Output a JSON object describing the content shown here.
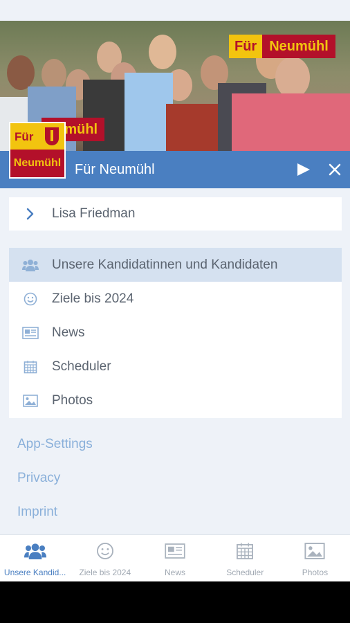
{
  "header": {
    "banner_left": "Für",
    "banner_right": "Neumühl",
    "banner2_right": "eumühl",
    "logo_top": "Für",
    "logo_bottom": "Neumühl",
    "title": "Für Neumühl"
  },
  "user": {
    "name": "Lisa Friedman"
  },
  "menu": {
    "items": [
      {
        "label": "Unsere Kandidatinnen und Kandidaten",
        "icon": "users-icon",
        "active": true
      },
      {
        "label": "Ziele bis 2024",
        "icon": "smiley-icon"
      },
      {
        "label": "News",
        "icon": "newspaper-icon"
      },
      {
        "label": "Scheduler",
        "icon": "calendar-icon"
      },
      {
        "label": "Photos",
        "icon": "image-icon"
      }
    ]
  },
  "links": [
    "App-Settings",
    "Privacy",
    "Imprint"
  ],
  "tabs": [
    {
      "label": "Unsere Kandid...",
      "icon": "users-icon",
      "active": true
    },
    {
      "label": "Ziele bis 2024",
      "icon": "smiley-icon"
    },
    {
      "label": "News",
      "icon": "newspaper-icon"
    },
    {
      "label": "Scheduler",
      "icon": "calendar-icon"
    },
    {
      "label": "Photos",
      "icon": "image-icon"
    }
  ],
  "colors": {
    "accent": "#4a7fc1",
    "brand_yellow": "#f2c40f",
    "brand_red": "#b3102a"
  }
}
